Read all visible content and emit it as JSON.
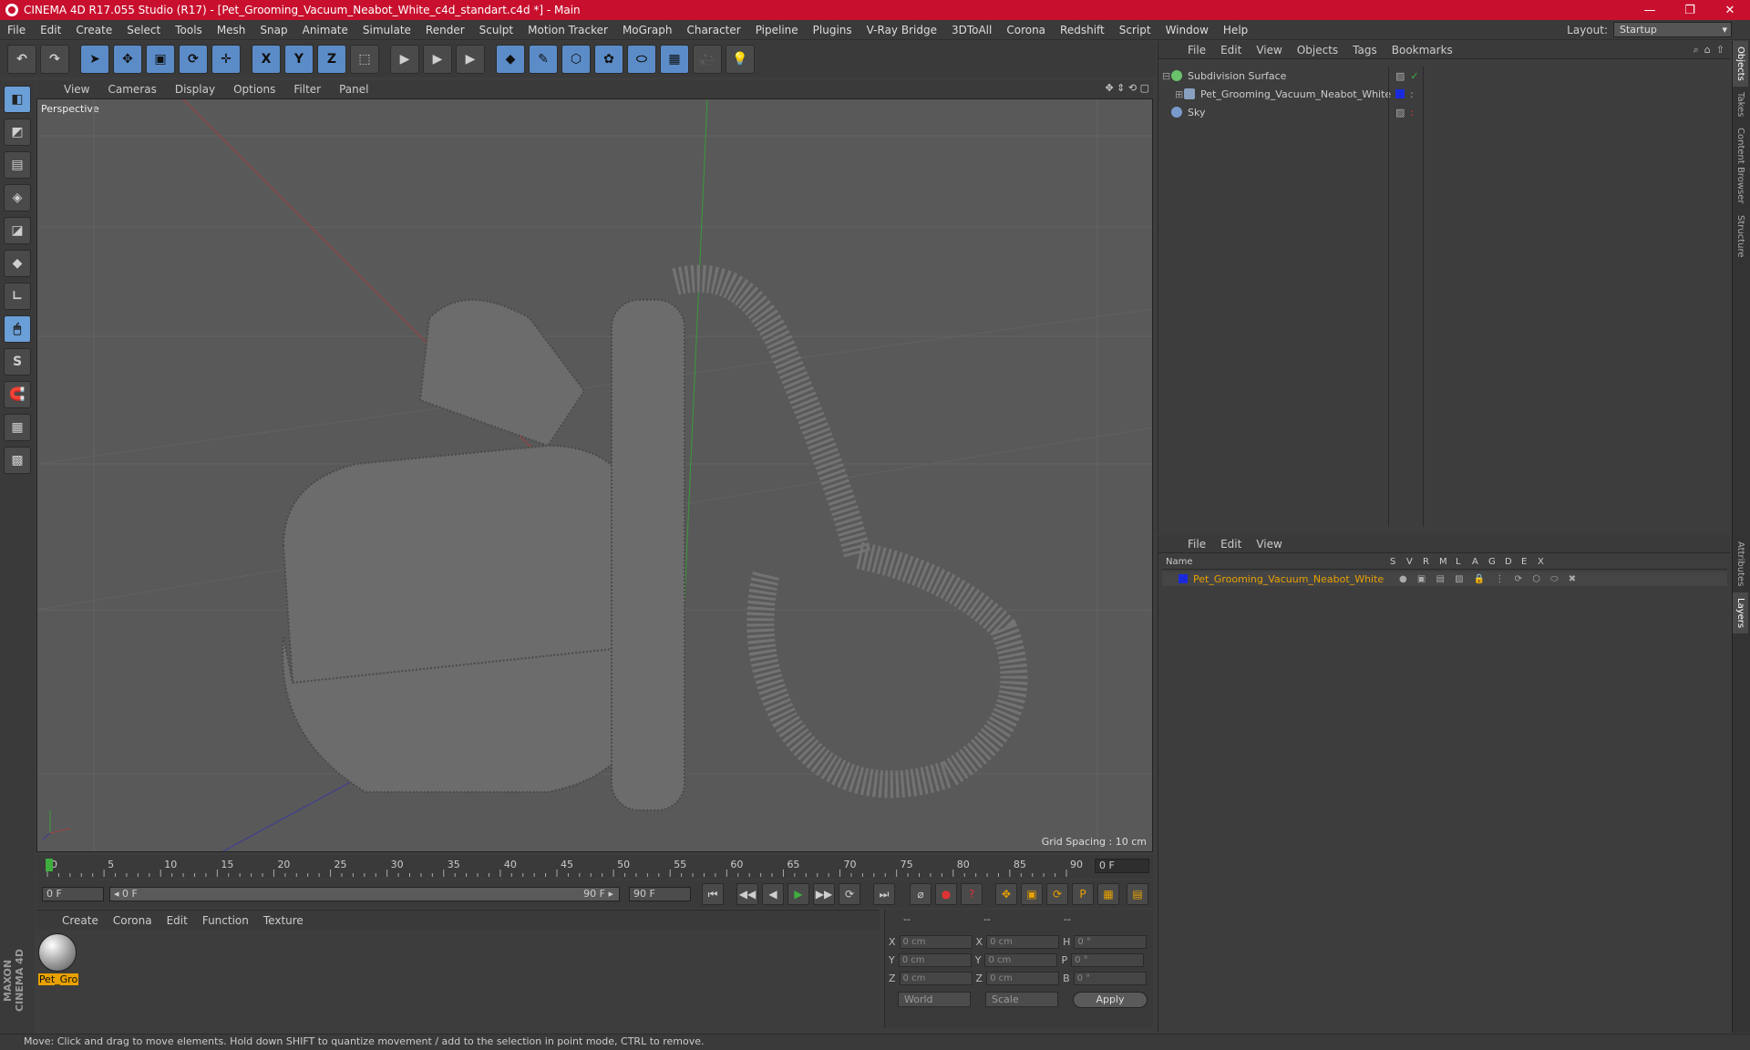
{
  "window": {
    "title": "CINEMA 4D R17.055 Studio (R17) - [Pet_Grooming_Vacuum_Neabot_White_c4d_standart.c4d *] - Main",
    "minimize": "—",
    "maximize": "❐",
    "close": "✕"
  },
  "menu": [
    "File",
    "Edit",
    "Create",
    "Select",
    "Tools",
    "Mesh",
    "Snap",
    "Animate",
    "Simulate",
    "Render",
    "Sculpt",
    "Motion Tracker",
    "MoGraph",
    "Character",
    "Pipeline",
    "Plugins",
    "V-Ray Bridge",
    "3DToAll",
    "Corona",
    "Redshift",
    "Script",
    "Window",
    "Help"
  ],
  "layout": {
    "label": "Layout:",
    "value": "Startup"
  },
  "toolbar": {
    "undo": "↶",
    "redo": "↷",
    "select": "➤",
    "move": "✥",
    "scale": "▣",
    "rotate": "⟳",
    "transform": "✛",
    "x": "X",
    "y": "Y",
    "z": "Z",
    "coord": "⬚",
    "render1": "▶",
    "render2": "▶",
    "render3": "▶",
    "cube": "◆",
    "pen": "✎",
    "subdiv": "⬡",
    "mograph": "✿",
    "deformer": "⬭",
    "floor": "▦",
    "camera": "🎥",
    "light": "💡"
  },
  "lefttools": [
    "◧",
    "◩",
    "▤",
    "◈",
    "◪",
    "◆",
    "∟",
    "🖱",
    "S",
    "🧲",
    "▦",
    "▩"
  ],
  "maxon": "MAXON CINEMA 4D",
  "viewport": {
    "menu": [
      "View",
      "Cameras",
      "Display",
      "Options",
      "Filter",
      "Panel"
    ],
    "label": "Perspective",
    "grid_spacing": "Grid Spacing : 10 cm",
    "nav": "✥ ⇕ ⟲ ▢"
  },
  "timeline": {
    "ticks": [
      "0",
      "5",
      "10",
      "15",
      "20",
      "25",
      "30",
      "35",
      "40",
      "45",
      "50",
      "55",
      "60",
      "65",
      "70",
      "75",
      "80",
      "85",
      "90"
    ],
    "frame": "0 F"
  },
  "transport": {
    "start": "0 F",
    "slider_left": "◂ 0 F",
    "slider_right": "90 F ▸",
    "end": "90 F",
    "buttons": [
      "⏮",
      "◀◀",
      "◀",
      "▶",
      "▶▶",
      "⟳",
      "⏭"
    ]
  },
  "materials": {
    "menu": [
      "Create",
      "Corona",
      "Edit",
      "Function",
      "Texture"
    ],
    "item": "Pet_Gro"
  },
  "coords": {
    "headers": [
      "--",
      "--",
      "--"
    ],
    "rows": [
      [
        "X",
        "0 cm",
        "X",
        "0 cm",
        "H",
        "0 °"
      ],
      [
        "Y",
        "0 cm",
        "Y",
        "0 cm",
        "P",
        "0 °"
      ],
      [
        "Z",
        "0 cm",
        "Z",
        "0 cm",
        "B",
        "0 °"
      ]
    ],
    "world": "World",
    "scale": "Scale",
    "apply": "Apply"
  },
  "objects": {
    "menu": [
      "File",
      "Edit",
      "View",
      "Objects",
      "Tags",
      "Bookmarks"
    ],
    "items": [
      {
        "name": "Subdivision Surface",
        "color": "#6ac26a"
      },
      {
        "name": "Pet_Grooming_Vacuum_Neabot_White",
        "color": "#8aa0c0"
      },
      {
        "name": "Sky",
        "color": "#7a9acc"
      }
    ]
  },
  "layers": {
    "menu": [
      "File",
      "Edit",
      "View"
    ],
    "columns": [
      "Name",
      "S",
      "V",
      "R",
      "M",
      "L",
      "A",
      "G",
      "D",
      "E",
      "X"
    ],
    "row": "Pet_Grooming_Vacuum_Neabot_White"
  },
  "sidetabs": [
    "Objects",
    "Takes",
    "Content Browser",
    "Structure",
    "Attributes",
    "Layers"
  ],
  "status": "Move: Click and drag to move elements. Hold down SHIFT to quantize movement / add to the selection in point mode, CTRL to remove."
}
